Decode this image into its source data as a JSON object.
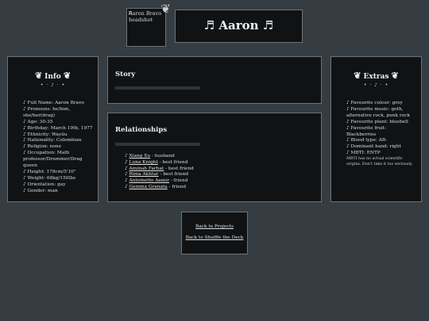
{
  "header": {
    "headshot_alt": "Aaron Bravo headshot",
    "corner_icon": "wing-icon",
    "title": "♬ Aaron ♬"
  },
  "info": {
    "heading": "Info",
    "heading_icon": "wing-icon",
    "divider": "• · ♪ · •",
    "items": [
      "♪ Full Name: Aaron Bravo",
      "♪ Pronouns: he/him, she/her(drag)",
      "♪ Age: 30-35",
      "♪ Birthday: March 19th, 1977",
      "♪ Ethnicity: Wayúu",
      "♪ Nationality: Colombian",
      "♪ Religion: none",
      "♪ Occupation: Math professor/Drummer/Drag queen",
      "♪ Height: 178cm/5'10\"",
      "♪ Weight: 68kg/150lbs",
      "♪ Orientation: gay",
      "♪ Gender: man"
    ]
  },
  "story": {
    "heading": "Story"
  },
  "relationships": {
    "heading": "Relationships",
    "items": [
      {
        "name": "Xiang Xu",
        "role": " - husband"
      },
      {
        "name": "Luna Knight",
        "role": " - best friend"
      },
      {
        "name": "Aminah Farhat",
        "role": " - best friend"
      },
      {
        "name": "Rima Akhtar",
        "role": " - best friend"
      },
      {
        "name": "Antoinette Aamir",
        "role": " - friend"
      },
      {
        "name": "Gemma Granata",
        "role": " - friend"
      }
    ]
  },
  "extras": {
    "heading": "Extras",
    "heading_icon": "wing-icon",
    "divider": "• · ♪ · •",
    "items": [
      "♪ Favourite colour: grey",
      "♪ Favourite music: goth, alternative rock, punk rock",
      "♪ Favourite plant: bluebell",
      "♪ Favourite fruit: Blackberries",
      "♪ Blood type: AB-",
      "♪ Dominant hand: right",
      "♪ MBTI: ENTP"
    ],
    "note": "MBTI has no actual scientific origins. Don't take it too seriously."
  },
  "nav": {
    "back_projects": "Back to Projects",
    "back_deck": "Back to Shuffle the Deck"
  },
  "colors": {
    "background": "#363d42",
    "panel": "#101214",
    "border": "#6b7278"
  }
}
